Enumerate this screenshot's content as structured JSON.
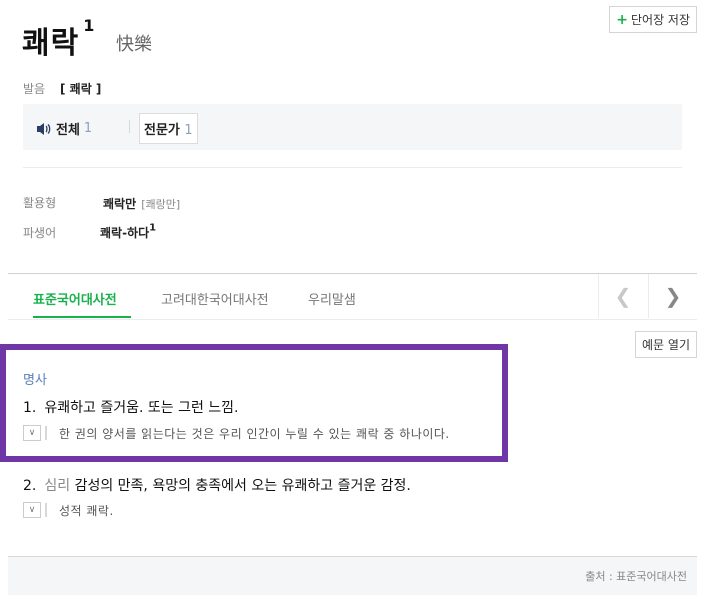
{
  "entry": {
    "headword": "쾌락",
    "sup": "1",
    "hanja": "快樂",
    "save_label": "단어장 저장"
  },
  "pronunciation": {
    "label": "발음",
    "value": "[ 쾌락 ]"
  },
  "audio": {
    "all_label": "전체",
    "all_count": "1",
    "expert_label": "전문가",
    "expert_count": "1"
  },
  "forms": [
    {
      "label": "활용형",
      "value": "쾌락만",
      "sub": "[쾌랑만]",
      "sup": ""
    },
    {
      "label": "파생어",
      "value": "쾌락-하다",
      "sub": "",
      "sup": "1"
    }
  ],
  "tabs": [
    "표준국어대사전",
    "고려대한국어대사전",
    "우리말샘"
  ],
  "example_toggle_label": "예문 열기",
  "definitions": {
    "pos": "명사",
    "senses": [
      {
        "num": "1.",
        "field": "",
        "text": "유쾌하고 즐거움. 또는 그런 느낌.",
        "example": "한 권의 양서를 읽는다는 것은 우리 인간이 누릴 수 있는 쾌락 중 하나이다."
      },
      {
        "num": "2.",
        "field": "심리",
        "text": "감성의 만족, 욕망의 충족에서 오는 유쾌하고 즐거운 감정.",
        "example": "성적 쾌락."
      }
    ]
  },
  "source": "출처 : 표준국어대사전",
  "colors": {
    "accent": "#19b14d",
    "highlight_border": "#6f36a5",
    "pos": "#5a7fbf"
  }
}
